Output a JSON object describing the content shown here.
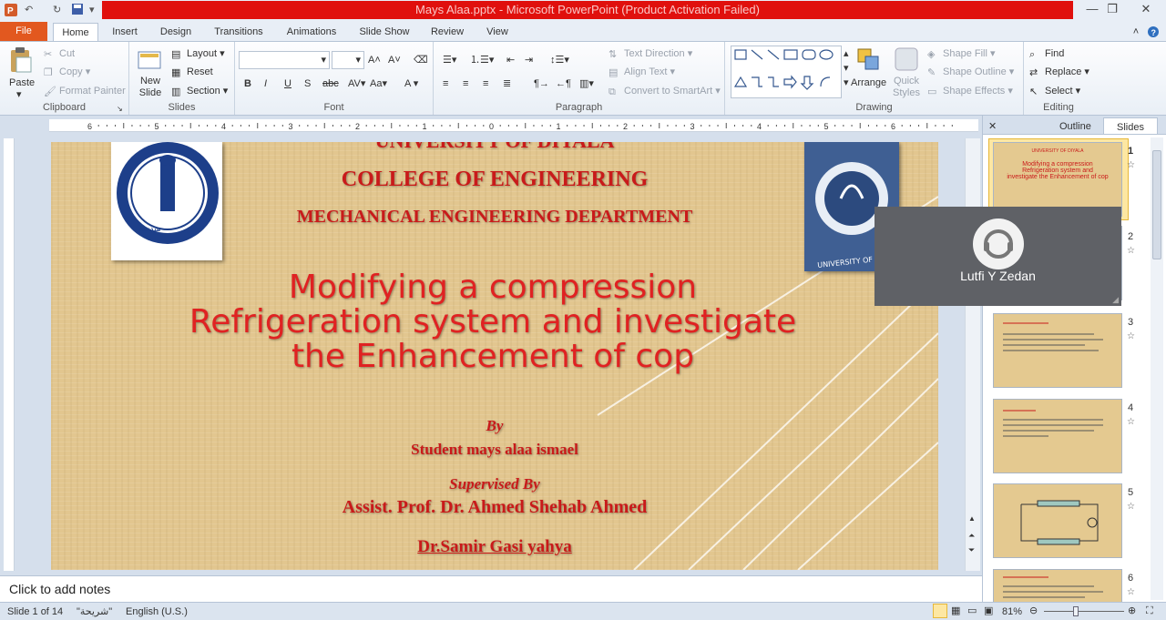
{
  "window": {
    "title": "Mays Alaa.pptx - Microsoft PowerPoint (Product Activation Failed)",
    "minimize": "—",
    "restore": "❐",
    "close": "✕"
  },
  "tabs": [
    {
      "label": "File"
    },
    {
      "label": "Home"
    },
    {
      "label": "Insert"
    },
    {
      "label": "Design"
    },
    {
      "label": "Transitions"
    },
    {
      "label": "Animations"
    },
    {
      "label": "Slide Show"
    },
    {
      "label": "Review"
    },
    {
      "label": "View"
    }
  ],
  "ribbon": {
    "clipboard": {
      "label": "Clipboard",
      "paste": "Paste",
      "cut": "Cut",
      "copy": "Copy",
      "format_painter": "Format Painter"
    },
    "slides": {
      "label": "Slides",
      "new_slide": "New Slide",
      "layout": "Layout",
      "reset": "Reset",
      "section": "Section"
    },
    "font": {
      "label": "Font",
      "font_name": "",
      "font_size": ""
    },
    "paragraph": {
      "label": "Paragraph",
      "text_direction": "Text Direction",
      "align_text": "Align Text",
      "convert_smartart": "Convert to SmartArt"
    },
    "drawing": {
      "label": "Drawing",
      "arrange": "Arrange",
      "quick_styles": "Quick Styles",
      "shape_fill": "Shape Fill",
      "shape_outline": "Shape Outline",
      "shape_effects": "Shape Effects"
    },
    "editing": {
      "label": "Editing",
      "find": "Find",
      "replace": "Replace",
      "select": "Select"
    }
  },
  "slide": {
    "university": "UNIVERSITY OF DIYALA",
    "college": "COLLEGE OF ENGINEERING",
    "department": "MECHANICAL ENGINEERING DEPARTMENT",
    "title": "Modifying a compression Refrigeration system and investigate the Enhancement of cop",
    "by": "By",
    "student": "Student mays alaa ismael",
    "supervised": "Supervised By",
    "supervisor1": "Assist. Prof. Dr. Ahmed Shehab Ahmed",
    "supervisor2": "Dr.Samir Gasi yahya",
    "logo_left_text": "COLLEGE OF ENGINEERING",
    "logo_right_text": "UNIVERSITY OF DIYALA"
  },
  "notes": {
    "placeholder": "Click to add notes"
  },
  "sidepane": {
    "outline_tab": "Outline",
    "slides_tab": "Slides",
    "close": "✕",
    "slide_numbers": [
      "1",
      "2",
      "3",
      "4",
      "5",
      "6"
    ]
  },
  "overlay": {
    "name": "Lutfi Y Zedan"
  },
  "status": {
    "slide_info": "Slide 1 of 14",
    "theme": "\"شريحة\"",
    "language": "English (U.S.)",
    "zoom": "81%",
    "zoom_level": 0.81
  },
  "colors": {
    "title_red": "#c91a1a",
    "file_tab": "#e2581f",
    "activation_bar": "#e0100d"
  }
}
